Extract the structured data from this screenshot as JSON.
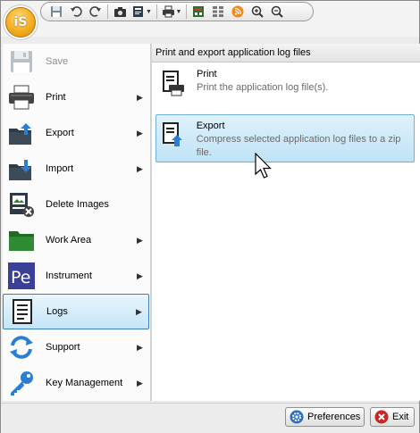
{
  "app": {
    "orb_label": "iS"
  },
  "qat": [
    {
      "icon": "save-icon"
    },
    {
      "icon": "undo-icon"
    },
    {
      "icon": "redo-icon"
    },
    {
      "icon": "camera-icon"
    },
    {
      "icon": "report-icon"
    },
    {
      "icon": "printer-icon"
    },
    {
      "icon": "grid-view-icon"
    },
    {
      "icon": "multi-grid-icon"
    },
    {
      "icon": "rss-icon"
    },
    {
      "icon": "zoom-in-icon"
    },
    {
      "icon": "zoom-out-icon"
    }
  ],
  "menu": {
    "items": [
      {
        "label": "Save",
        "icon": "save-icon",
        "submenu": false,
        "enabled": false
      },
      {
        "label": "Print",
        "icon": "printer-icon",
        "submenu": true
      },
      {
        "label": "Export",
        "icon": "export-folder-icon",
        "submenu": true
      },
      {
        "label": "Import",
        "icon": "import-folder-icon",
        "submenu": true
      },
      {
        "label": "Delete Images",
        "icon": "delete-images-icon",
        "submenu": false
      },
      {
        "label": "Work Area",
        "icon": "green-folder-icon",
        "submenu": true
      },
      {
        "label": "Instrument",
        "icon": "pe-icon",
        "submenu": true
      },
      {
        "label": "Logs",
        "icon": "logs-icon",
        "submenu": true,
        "active": true
      },
      {
        "label": "Support",
        "icon": "support-icon",
        "submenu": true
      },
      {
        "label": "Key Management",
        "icon": "key-icon",
        "submenu": true
      }
    ]
  },
  "pe_text": "Pe",
  "panel": {
    "header": "Print and export application log files",
    "items": [
      {
        "title": "Print",
        "description": "Print the application log file(s).",
        "icon": "print-document-icon"
      },
      {
        "title": "Export",
        "description": "Compress selected application log files to a zip file.",
        "icon": "export-document-icon",
        "highlighted": true
      }
    ]
  },
  "buttons": {
    "preferences": "Preferences",
    "exit": "Exit"
  },
  "colors": {
    "active_border": "#3c7fb1",
    "highlight_fill": "#bfe3f6",
    "orb": "#f7b42c"
  }
}
